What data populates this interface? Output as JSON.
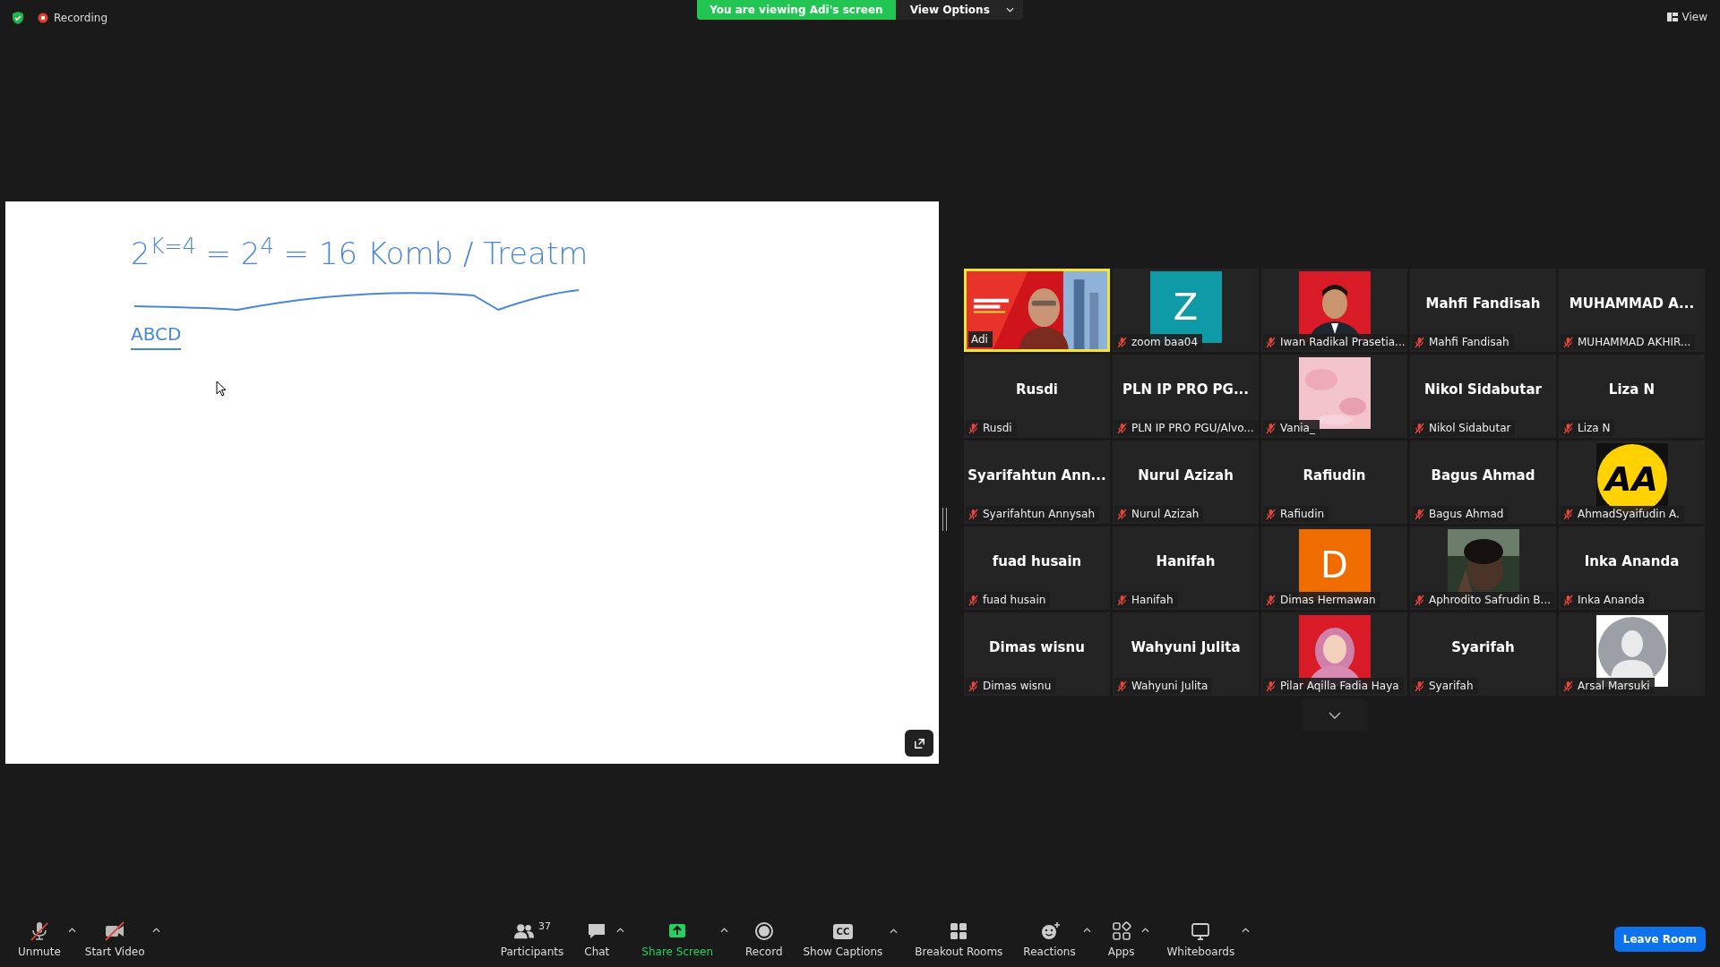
{
  "top_bar": {
    "recording": "Recording",
    "viewing_banner": "You are viewing Adi's screen",
    "view_options": "View Options",
    "view": "View"
  },
  "shared_screen": {
    "equation": "2$^{K=4}$ = 2$^{4}$ = 16 Komb / Treatm",
    "note": "ABCD"
  },
  "gallery": [
    {
      "kind": "video",
      "label": "Adi",
      "muted": false,
      "speaking": true
    },
    {
      "kind": "initial",
      "initial": "Z",
      "color": "#0e9aa7",
      "label": "zoom baa04",
      "muted": true,
      "speaking": false
    },
    {
      "label": "Iwan Radikal Prasetia...",
      "muted": true,
      "speaking": false
    },
    {
      "kind": "name",
      "display": "Mahfi Fandisah",
      "label": "Mahfi Fandisah",
      "muted": true,
      "speaking": false
    },
    {
      "kind": "name",
      "display": "MUHAMMAD  A...",
      "label": "MUHAMMAD AKHIR...",
      "muted": true,
      "speaking": false
    },
    {
      "kind": "name",
      "display": "Rusdi",
      "label": "Rusdi",
      "muted": true,
      "speaking": false
    },
    {
      "kind": "name",
      "display": "PLN IP PRO PG...",
      "label": "PLN IP PRO PGU/Alvo...",
      "muted": true,
      "speaking": false
    },
    {
      "label": "Vania_",
      "muted": true,
      "speaking": false
    },
    {
      "kind": "name",
      "display": "Nikol Sidabutar",
      "label": "Nikol Sidabutar",
      "muted": true,
      "speaking": false
    },
    {
      "kind": "name",
      "display": "Liza N",
      "label": "Liza N",
      "muted": true,
      "speaking": false
    },
    {
      "kind": "name",
      "display": "Syarifahtun  Ann...",
      "label": "Syarifahtun Annysah",
      "muted": true,
      "speaking": false
    },
    {
      "kind": "name",
      "display": "Nurul Azizah",
      "label": "Nurul Azizah",
      "muted": true,
      "speaking": false
    },
    {
      "kind": "name",
      "display": "Rafiudin",
      "label": "Rafiudin",
      "muted": true,
      "speaking": false
    },
    {
      "kind": "name",
      "display": "Bagus Ahmad",
      "label": "Bagus Ahmad",
      "muted": true,
      "speaking": false
    },
    {
      "kind": "logo",
      "initial": "AA",
      "color": "#ffd200",
      "label": "AhmadSyaifudin A.",
      "muted": true,
      "speaking": false
    },
    {
      "kind": "name",
      "display": "fuad husain",
      "label": "fuad husain",
      "muted": true,
      "speaking": false
    },
    {
      "kind": "name",
      "display": "Hanifah",
      "label": "Hanifah",
      "muted": true,
      "speaking": false
    },
    {
      "kind": "initial",
      "initial": "D",
      "color": "#ef6c00",
      "label": "Dimas Hermawan",
      "muted": true,
      "speaking": false
    },
    {
      "label": "Aphrodito Safrudin B...",
      "muted": true,
      "speaking": false
    },
    {
      "kind": "name",
      "display": "Inka Ananda",
      "label": "Inka Ananda",
      "muted": true,
      "speaking": false
    },
    {
      "kind": "name",
      "display": "Dimas wisnu",
      "label": "Dimas wisnu",
      "muted": true,
      "speaking": false
    },
    {
      "kind": "name",
      "display": "Wahyuni Julita",
      "label": "Wahyuni Julita",
      "muted": true,
      "speaking": false
    },
    {
      "label": "Pilar Aqilla Fadia Haya",
      "muted": true,
      "speaking": false
    },
    {
      "kind": "name",
      "display": "Syarifah",
      "label": "Syarifah",
      "muted": true,
      "speaking": false
    },
    {
      "kind": "default",
      "label": "Arsal Marsuki",
      "muted": true,
      "speaking": false
    }
  ],
  "toolbar_left": [
    {
      "kind": "mic",
      "label": "Unmute",
      "menu": true
    },
    {
      "kind": "camera",
      "label": "Start Video",
      "menu": true
    }
  ],
  "toolbar_center": [
    {
      "kind": "participants",
      "label": "Participants",
      "count": "37",
      "menu": false,
      "highlight": false
    },
    {
      "kind": "chat",
      "label": "Chat",
      "menu": true,
      "highlight": false
    },
    {
      "kind": "share",
      "label": "Share Screen",
      "menu": true,
      "highlight": true
    },
    {
      "kind": "record",
      "label": "Record",
      "menu": false,
      "highlight": false
    },
    {
      "kind": "captions",
      "label": "Show Captions",
      "glyph": "CC",
      "menu": true,
      "highlight": false
    },
    {
      "kind": "breakout",
      "label": "Breakout Rooms",
      "menu": false,
      "highlight": false
    },
    {
      "kind": "reactions",
      "label": "Reactions",
      "menu": true,
      "highlight": false
    },
    {
      "kind": "apps",
      "label": "Apps",
      "menu": true,
      "highlight": false
    },
    {
      "kind": "whiteboards",
      "label": "Whiteboards",
      "menu": true,
      "highlight": false
    }
  ],
  "leave_button": "Leave Room"
}
